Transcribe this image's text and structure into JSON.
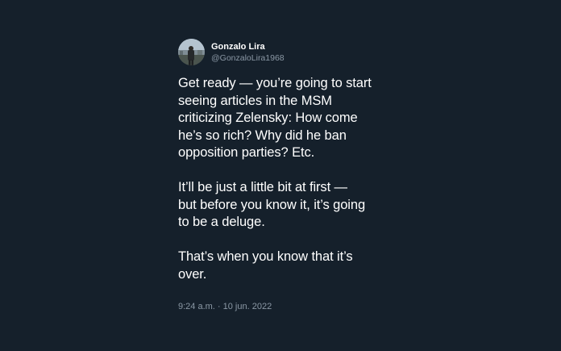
{
  "tweet": {
    "author": {
      "name": "Gonzalo Lira",
      "handle": "@GonzaloLira1968",
      "avatar_icon": "profile-photo"
    },
    "lines": {
      "p1": [
        "Get ready — you’re going to start",
        "seeing articles in the MSM",
        "criticizing Zelensky: How come",
        "he’s so rich? Why did he ban",
        "opposition parties? Etc."
      ],
      "p2": [
        "It’ll be just a little bit at first —",
        "but before you know it, it’s going",
        "to be a deluge."
      ],
      "p3": [
        "That’s when you know that it’s",
        "over."
      ]
    },
    "timestamp": "9:24 a.m. · 10 jun. 2022"
  },
  "colors": {
    "background": "#15202b",
    "text_primary": "#ffffff",
    "text_secondary": "#8b98a5"
  }
}
